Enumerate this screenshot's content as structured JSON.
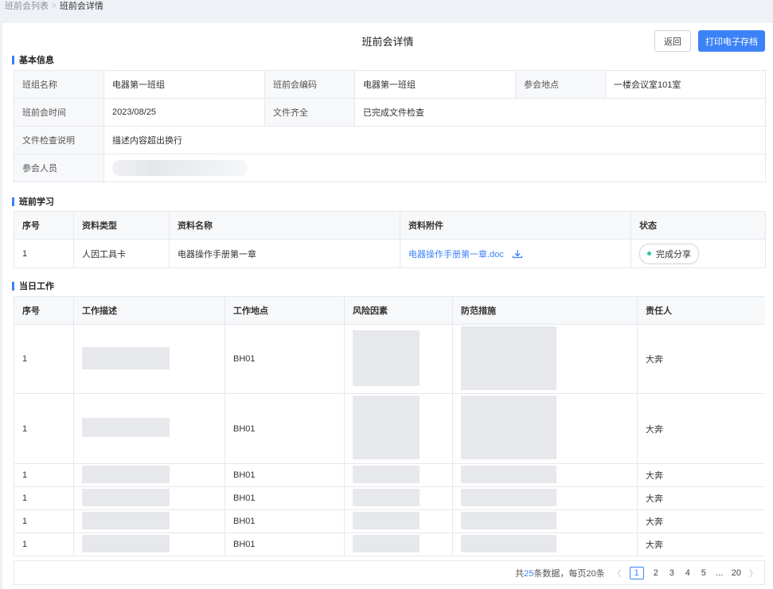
{
  "breadcrumb": {
    "parent": "班前会列表",
    "current": "班前会详情"
  },
  "header": {
    "title": "班前会详情",
    "back_label": "返回",
    "print_label": "打印电子存档"
  },
  "basic_info": {
    "section_title": "基本信息",
    "team_name_label": "班组名称",
    "team_name": "电器第一班组",
    "code_label": "班前会编码",
    "code": "电器第一班组",
    "location_label": "参会地点",
    "location": "一楼会议室101室",
    "time_label": "班前会时间",
    "time": "2023/08/25",
    "files_label": "文件齐全",
    "files": "已完成文件检查",
    "check_note_label": "文件检查说明",
    "check_note": "描述内容超出换行",
    "attendees_label": "参会人员"
  },
  "study": {
    "section_title": "班前学习",
    "columns": [
      "序号",
      "资料类型",
      "资料名称",
      "资料附件",
      "状态"
    ],
    "rows": [
      {
        "no": "1",
        "type": "人因工具卡",
        "name": "电器操作手册第一章",
        "attachment": "电器操作手册第一章.doc",
        "status": "完成分享"
      }
    ]
  },
  "work": {
    "section_title": "当日工作",
    "columns": [
      "序号",
      "工作描述",
      "工作地点",
      "风险因素",
      "防范措施",
      "责任人"
    ],
    "rows": [
      {
        "no": "1",
        "location": "BH01",
        "owner": "大奔"
      },
      {
        "no": "1",
        "location": "BH01",
        "owner": "大奔"
      },
      {
        "no": "1",
        "location": "BH01",
        "owner": "大奔"
      },
      {
        "no": "1",
        "location": "BH01",
        "owner": "大奔"
      },
      {
        "no": "1",
        "location": "BH01",
        "owner": "大奔"
      },
      {
        "no": "1",
        "location": "BH01",
        "owner": "大奔"
      }
    ]
  },
  "pagination": {
    "prefix": "共",
    "total": "25",
    "suffix": "条数据，每页20条",
    "pages": [
      "1",
      "2",
      "3",
      "4",
      "5"
    ],
    "ellipsis": "...",
    "last": "20",
    "prev": "〈",
    "next": "〉"
  },
  "colors": {
    "accent": "#3b82f6",
    "status_dot": "#2ec4a7"
  }
}
